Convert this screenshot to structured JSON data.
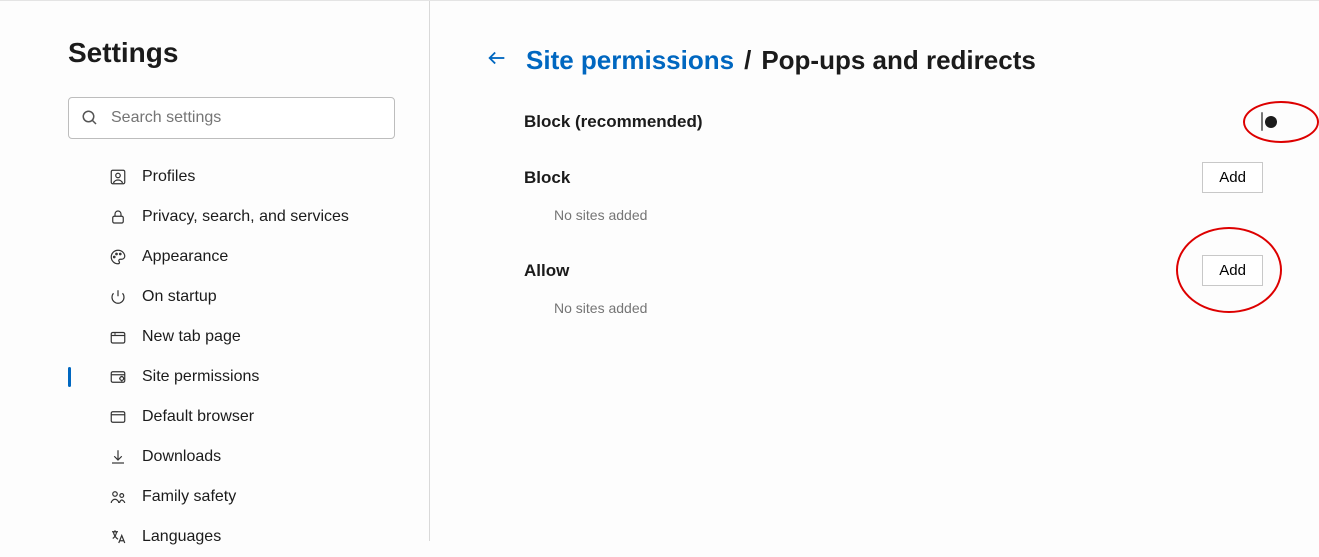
{
  "sidebar": {
    "title": "Settings",
    "search_placeholder": "Search settings",
    "items": [
      {
        "label": "Profiles",
        "icon": "profile-icon"
      },
      {
        "label": "Privacy, search, and services",
        "icon": "lock-icon"
      },
      {
        "label": "Appearance",
        "icon": "palette-icon"
      },
      {
        "label": "On startup",
        "icon": "power-icon"
      },
      {
        "label": "New tab page",
        "icon": "tab-icon"
      },
      {
        "label": "Site permissions",
        "icon": "permissions-icon",
        "selected": true
      },
      {
        "label": "Default browser",
        "icon": "browser-icon"
      },
      {
        "label": "Downloads",
        "icon": "download-icon"
      },
      {
        "label": "Family safety",
        "icon": "family-icon"
      },
      {
        "label": "Languages",
        "icon": "language-icon"
      }
    ]
  },
  "breadcrumb": {
    "parent": "Site permissions",
    "separator": "/",
    "current": "Pop-ups and redirects"
  },
  "main": {
    "block_toggle_label": "Block (recommended)",
    "block_toggle_on": false,
    "block_section_label": "Block",
    "block_empty": "No sites added",
    "block_add_label": "Add",
    "allow_section_label": "Allow",
    "allow_empty": "No sites added",
    "allow_add_label": "Add"
  },
  "annotations": {
    "circle_toggle": true,
    "circle_allow_add": true
  }
}
